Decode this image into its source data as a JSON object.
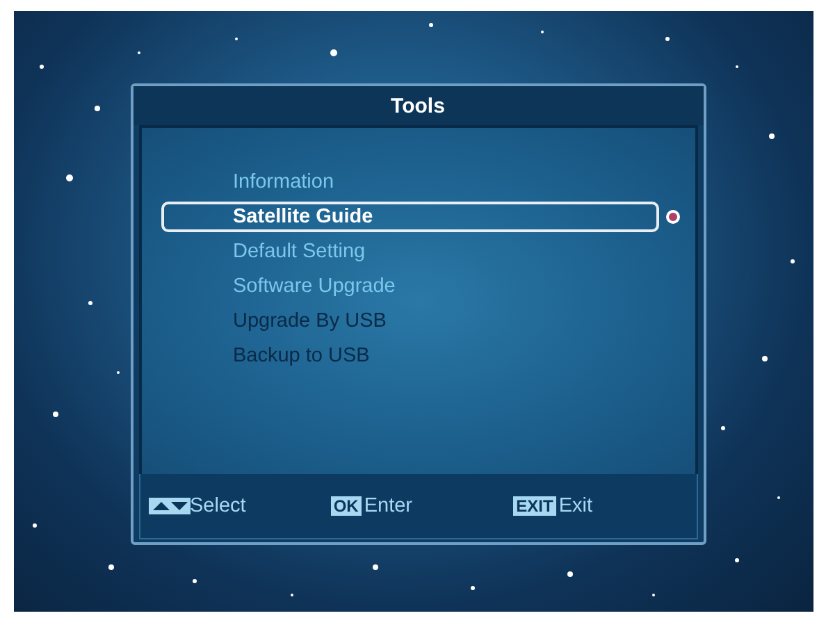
{
  "dialog": {
    "title": "Tools"
  },
  "menu": [
    {
      "label": "Information",
      "selected": false,
      "disabled": false
    },
    {
      "label": "Satellite Guide",
      "selected": true,
      "disabled": false
    },
    {
      "label": "Default Setting",
      "selected": false,
      "disabled": false
    },
    {
      "label": "Software Upgrade",
      "selected": false,
      "disabled": false
    },
    {
      "label": "Upgrade By USB",
      "selected": false,
      "disabled": true
    },
    {
      "label": "Backup to USB",
      "selected": false,
      "disabled": true
    }
  ],
  "footer": [
    {
      "kind": "arrows",
      "label": "Select"
    },
    {
      "kind": "key",
      "key": "OK",
      "label": "Enter"
    },
    {
      "kind": "key",
      "key": "EXIT",
      "label": "Exit"
    }
  ]
}
